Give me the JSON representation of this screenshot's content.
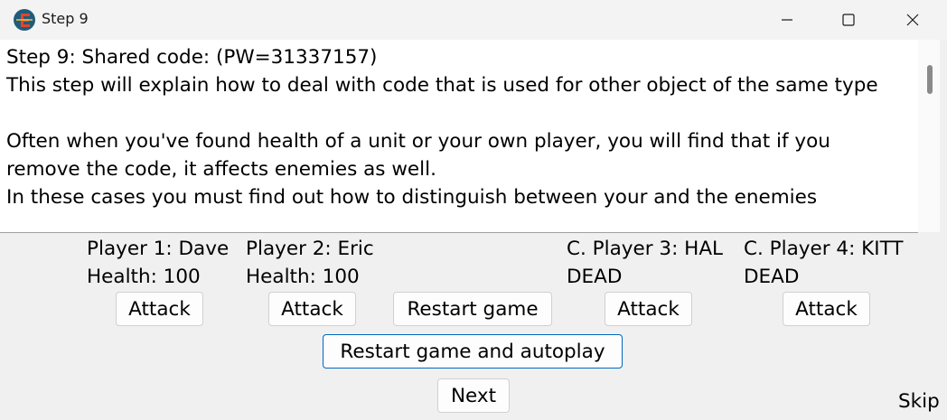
{
  "window": {
    "title": "Step 9",
    "icons": {
      "app": "cheat-engine-logo-icon",
      "minimize": "minimize-icon",
      "maximize": "maximize-icon",
      "close": "close-icon"
    }
  },
  "instructions": {
    "text": "Step 9: Shared code: (PW=31337157)\nThis step will explain how to deal with code that is used for other object of the same type\n\nOften when you've found health of a unit or your own player, you will find that if you remove the code, it affects enemies as well.\nIn these cases you must find out how to distinguish between your and the enemies"
  },
  "players": [
    {
      "name": "Player 1: Dave",
      "status": "Health: 100",
      "button": "Attack"
    },
    {
      "name": "Player 2: Eric",
      "status": "Health: 100",
      "button": "Attack"
    },
    {
      "name": "C. Player 3: HAL",
      "status": "DEAD",
      "button": "Attack"
    },
    {
      "name": "C. Player 4: KITT",
      "status": "DEAD",
      "button": "Attack"
    }
  ],
  "actions": {
    "restart": "Restart game",
    "restart_autoplay": "Restart game and autoplay",
    "next": "Next",
    "skip": "Skip"
  }
}
